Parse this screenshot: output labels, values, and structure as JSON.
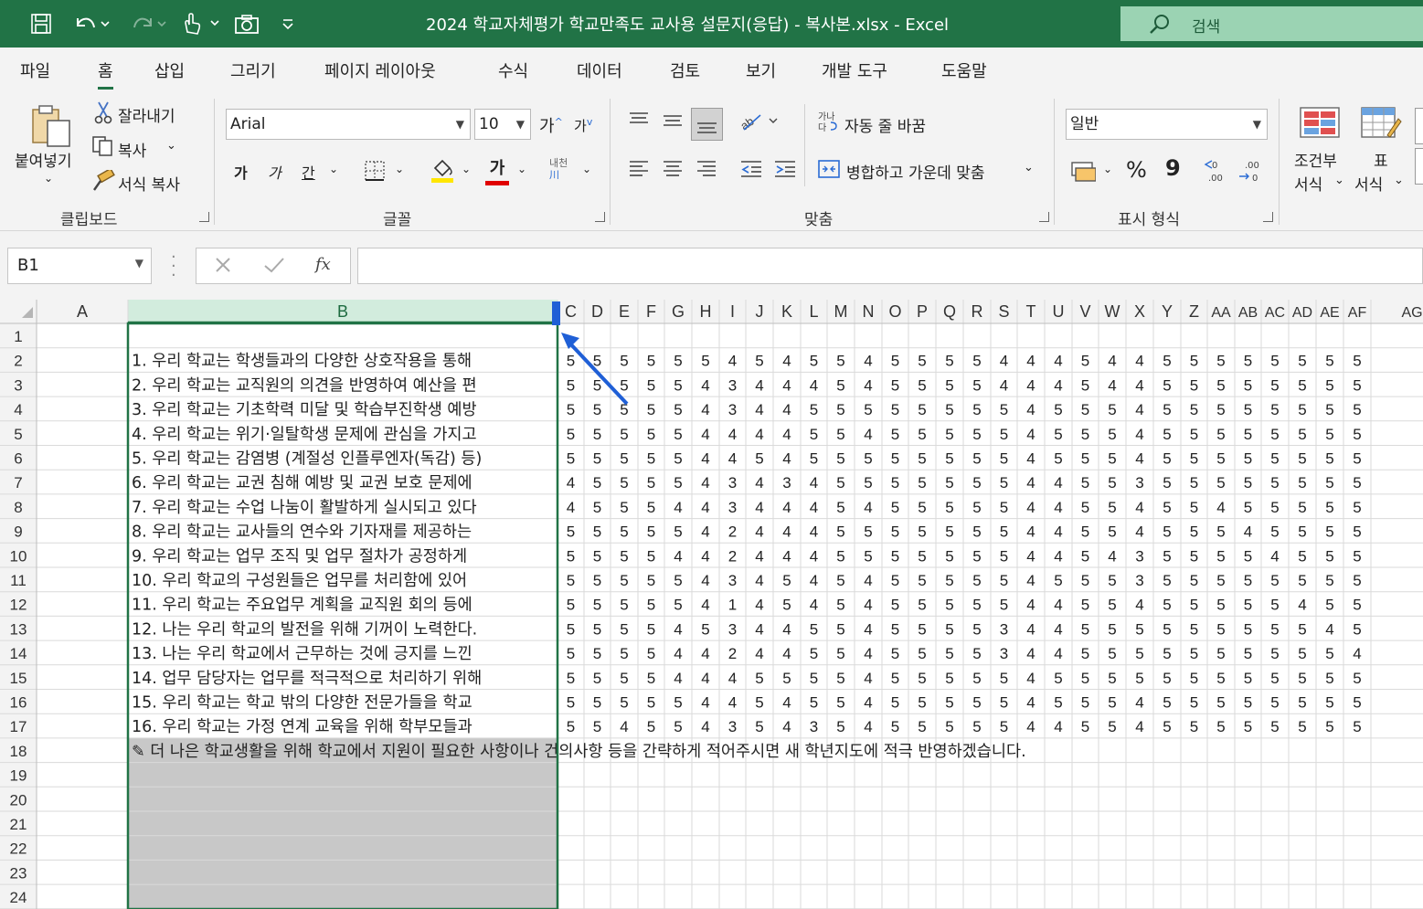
{
  "window": {
    "title": "2024 학교자체평가 학교만족도 교사용 설문지(응답) - 복사본.xlsx  -  Excel",
    "search_placeholder": "검색"
  },
  "colors": {
    "brand": "#217346",
    "selection": "#217346",
    "drag_indicator": "#1f5fd6",
    "grey_fill": "#c8c8c8"
  },
  "quick_access": [
    "save-icon",
    "undo-icon",
    "redo-icon",
    "touch-mode-icon",
    "camera-icon",
    "customize-icon"
  ],
  "menu": {
    "tabs": [
      "파일",
      "홈",
      "삽입",
      "그리기",
      "페이지 레이아웃",
      "수식",
      "데이터",
      "검토",
      "보기",
      "개발 도구",
      "도움말"
    ],
    "active": "홈"
  },
  "ribbon": {
    "clipboard": {
      "paste": "붙여넣기",
      "cut": "잘라내기",
      "copy": "복사",
      "format_painter": "서식 복사",
      "group": "클립보드"
    },
    "font": {
      "name": "Arial",
      "size": "10",
      "grow": "가",
      "shrink": "가",
      "bold": "가",
      "italic": "가",
      "underline": "간",
      "group": "글꼴",
      "phonetic": "내천",
      "font_color": "가"
    },
    "alignment": {
      "wrap": "자동 줄 바꿈",
      "merge": "병합하고 가운데 맞춤",
      "group": "맞춤"
    },
    "number": {
      "format": "일반",
      "percent": "%",
      "comma": "9",
      "group": "표시 형식"
    },
    "styles": {
      "conditional_line1": "조건부",
      "conditional_line2": "서식",
      "table_line1": "표",
      "table_line2": "서식"
    }
  },
  "formula_bar": {
    "name_box": "B1",
    "formula": ""
  },
  "sheet": {
    "selected_column": "B",
    "columns": [
      "A",
      "B",
      "C",
      "D",
      "E",
      "F",
      "G",
      "H",
      "I",
      "J",
      "K",
      "L",
      "M",
      "N",
      "O",
      "P",
      "Q",
      "R",
      "S",
      "T",
      "U",
      "V",
      "W",
      "X",
      "Y",
      "Z",
      "AA",
      "AB",
      "AC",
      "AD",
      "AE",
      "AF",
      "AG"
    ],
    "row_numbers": [
      "1",
      "2",
      "3",
      "4",
      "5",
      "6",
      "7",
      "8",
      "9",
      "10",
      "11",
      "12",
      "13",
      "14",
      "15",
      "16",
      "17",
      "18",
      "19",
      "20",
      "21",
      "22",
      "23",
      "24"
    ],
    "questions": [
      "1. 우리 학교는 학생들과의 다양한 상호작용을 통해",
      "2. 우리 학교는 교직원의 의견을 반영하여 예산을 편",
      "3. 우리 학교는 기초학력 미달 및 학습부진학생 예방",
      "4. 우리 학교는 위기·일탈학생 문제에 관심을 가지고",
      "5. 우리 학교는 감염병 (계절성 인플루엔자(독감) 등)",
      "6. 우리 학교는 교권 침해 예방 및 교권 보호 문제에",
      "7. 우리 학교는 수업 나눔이 활발하게 실시되고 있다",
      "8. 우리 학교는 교사들의 연수와 기자재를 제공하는",
      "9. 우리 학교는 업무 조직 및 업무 절차가 공정하게",
      "10. 우리 학교의 구성원들은 업무를 처리함에 있어",
      "11. 우리 학교는 주요업무 계획을 교직원 회의 등에",
      "12. 나는 우리 학교의 발전을 위해 기꺼이 노력한다.",
      "13. 나는 우리 학교에서 근무하는 것에 긍지를 느낀",
      "14. 업무 담당자는 업무를 적극적으로 처리하기 위해",
      "15. 우리 학교는 학교 밖의 다양한 전문가들을 학교",
      "16. 우리 학교는 가정 연계 교육을 위해 학부모들과"
    ],
    "row18_text": "✎ 더 나은 학교생활을 위해 학교에서 지원이 필요한 사항이나 건의사항 등을 간략하게 적어주시면 새 학년지도에 적극 반영하겠습니다.",
    "responses": [
      [
        "5",
        "5",
        "5",
        "5",
        "5",
        "5",
        "4",
        "5",
        "4",
        "5",
        "5",
        "4",
        "5",
        "5",
        "5",
        "5",
        "4",
        "4",
        "4",
        "5",
        "4",
        "4",
        "5",
        "5",
        "5",
        "5",
        "5",
        "5",
        "5",
        "5"
      ],
      [
        "5",
        "5",
        "5",
        "5",
        "5",
        "4",
        "3",
        "4",
        "4",
        "4",
        "5",
        "4",
        "5",
        "5",
        "5",
        "5",
        "4",
        "4",
        "4",
        "5",
        "4",
        "4",
        "5",
        "5",
        "5",
        "5",
        "5",
        "5",
        "5",
        "5"
      ],
      [
        "5",
        "5",
        "5",
        "5",
        "5",
        "4",
        "3",
        "4",
        "4",
        "5",
        "5",
        "5",
        "5",
        "5",
        "5",
        "5",
        "5",
        "4",
        "5",
        "5",
        "5",
        "4",
        "5",
        "5",
        "5",
        "5",
        "5",
        "5",
        "5",
        "5"
      ],
      [
        "5",
        "5",
        "5",
        "5",
        "5",
        "4",
        "4",
        "4",
        "4",
        "5",
        "5",
        "4",
        "5",
        "5",
        "5",
        "5",
        "5",
        "4",
        "5",
        "5",
        "5",
        "4",
        "5",
        "5",
        "5",
        "5",
        "5",
        "5",
        "5",
        "5"
      ],
      [
        "5",
        "5",
        "5",
        "5",
        "5",
        "4",
        "4",
        "5",
        "4",
        "5",
        "5",
        "5",
        "5",
        "5",
        "5",
        "5",
        "5",
        "4",
        "5",
        "5",
        "5",
        "4",
        "5",
        "5",
        "5",
        "5",
        "5",
        "5",
        "5",
        "5"
      ],
      [
        "4",
        "5",
        "5",
        "5",
        "5",
        "4",
        "3",
        "4",
        "3",
        "4",
        "5",
        "5",
        "5",
        "5",
        "5",
        "5",
        "5",
        "4",
        "4",
        "5",
        "5",
        "3",
        "5",
        "5",
        "5",
        "5",
        "5",
        "5",
        "5",
        "5"
      ],
      [
        "4",
        "5",
        "5",
        "5",
        "4",
        "4",
        "3",
        "4",
        "4",
        "4",
        "5",
        "4",
        "5",
        "5",
        "5",
        "5",
        "5",
        "4",
        "4",
        "5",
        "5",
        "4",
        "5",
        "5",
        "4",
        "5",
        "5",
        "5",
        "5",
        "5"
      ],
      [
        "5",
        "5",
        "5",
        "5",
        "5",
        "4",
        "2",
        "4",
        "4",
        "4",
        "5",
        "5",
        "5",
        "5",
        "5",
        "5",
        "5",
        "4",
        "4",
        "5",
        "5",
        "4",
        "5",
        "5",
        "5",
        "4",
        "5",
        "5",
        "5",
        "5"
      ],
      [
        "5",
        "5",
        "5",
        "5",
        "4",
        "4",
        "2",
        "4",
        "4",
        "4",
        "5",
        "5",
        "5",
        "5",
        "5",
        "5",
        "5",
        "4",
        "4",
        "5",
        "4",
        "3",
        "5",
        "5",
        "5",
        "5",
        "4",
        "5",
        "5",
        "5"
      ],
      [
        "5",
        "5",
        "5",
        "5",
        "5",
        "4",
        "3",
        "4",
        "5",
        "4",
        "5",
        "4",
        "5",
        "5",
        "5",
        "5",
        "5",
        "4",
        "5",
        "5",
        "5",
        "3",
        "5",
        "5",
        "5",
        "5",
        "5",
        "5",
        "5",
        "5"
      ],
      [
        "5",
        "5",
        "5",
        "5",
        "5",
        "4",
        "1",
        "4",
        "5",
        "4",
        "5",
        "4",
        "5",
        "5",
        "5",
        "5",
        "5",
        "4",
        "4",
        "5",
        "5",
        "4",
        "5",
        "5",
        "5",
        "5",
        "5",
        "4",
        "5",
        "5"
      ],
      [
        "5",
        "5",
        "5",
        "5",
        "4",
        "5",
        "3",
        "4",
        "4",
        "5",
        "5",
        "4",
        "5",
        "5",
        "5",
        "5",
        "3",
        "4",
        "4",
        "5",
        "5",
        "5",
        "5",
        "5",
        "5",
        "5",
        "5",
        "5",
        "4",
        "5"
      ],
      [
        "5",
        "5",
        "5",
        "5",
        "4",
        "4",
        "2",
        "4",
        "4",
        "5",
        "5",
        "4",
        "5",
        "5",
        "5",
        "5",
        "3",
        "4",
        "4",
        "5",
        "5",
        "5",
        "5",
        "5",
        "5",
        "5",
        "5",
        "5",
        "5",
        "4"
      ],
      [
        "5",
        "5",
        "5",
        "5",
        "4",
        "4",
        "4",
        "5",
        "5",
        "5",
        "5",
        "4",
        "5",
        "5",
        "5",
        "5",
        "5",
        "4",
        "5",
        "5",
        "5",
        "5",
        "5",
        "5",
        "5",
        "5",
        "5",
        "5",
        "5",
        "5"
      ],
      [
        "5",
        "5",
        "5",
        "5",
        "5",
        "4",
        "4",
        "5",
        "4",
        "5",
        "5",
        "4",
        "5",
        "5",
        "5",
        "5",
        "5",
        "4",
        "5",
        "5",
        "5",
        "4",
        "5",
        "5",
        "5",
        "5",
        "5",
        "5",
        "5",
        "5"
      ],
      [
        "5",
        "5",
        "4",
        "5",
        "5",
        "4",
        "3",
        "5",
        "4",
        "3",
        "5",
        "4",
        "5",
        "5",
        "5",
        "5",
        "5",
        "4",
        "4",
        "5",
        "5",
        "4",
        "5",
        "5",
        "5",
        "5",
        "5",
        "5",
        "5",
        "5"
      ]
    ]
  }
}
